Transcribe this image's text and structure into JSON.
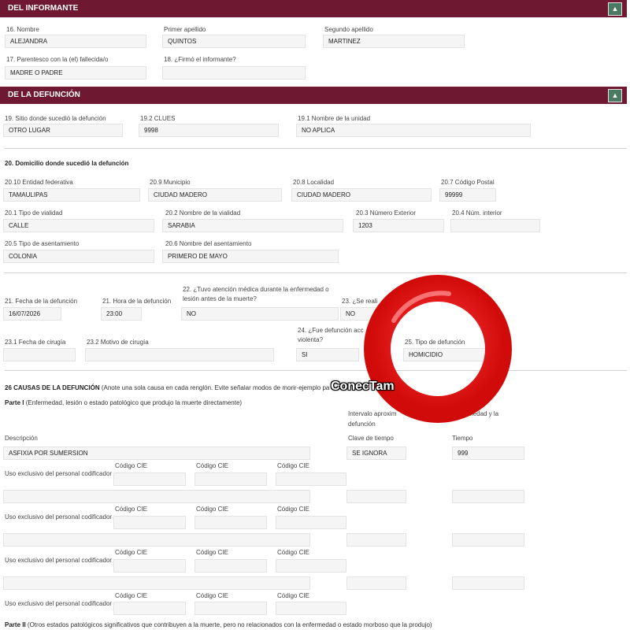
{
  "informante": {
    "header": "DEL INFORMANTE",
    "nombre_label": "16. Nombre",
    "nombre": "ALEJANDRA",
    "primer_apellido_label": "Primer apellido",
    "primer_apellido": "QUINTOS",
    "segundo_apellido_label": "Segundo apellido",
    "segundo_apellido": "MARTINEZ",
    "parentesco_label": "17. Parentesco con la (el) fallecida/o",
    "parentesco": "MADRE O PADRE",
    "firmo_label": "18. ¿Firmó el informante?",
    "firmo": ""
  },
  "defuncion": {
    "header": "DE LA DEFUNCIÓN",
    "sitio_label": "19. Sitio donde sucedió la defunción",
    "sitio": "OTRO LUGAR",
    "clues_label": "19.2 CLUES",
    "clues": "9998",
    "unidad_label": "19.1 Nombre de la unidad",
    "unidad": "NO APLICA",
    "domicilio_title": "20. Domicilio donde sucedió la defunción",
    "entidad_label": "20.10 Entidad federativa",
    "entidad": "TAMAULIPAS",
    "municipio_label": "20.9 Municipio",
    "municipio": "CIUDAD MADERO",
    "localidad_label": "20.8 Localidad",
    "localidad": "CIUDAD MADERO",
    "cp_label": "20.7 Código Postal",
    "cp": "99999",
    "tipo_vialidad_label": "20.1 Tipo de vialidad",
    "tipo_vialidad": "CALLE",
    "nombre_vialidad_label": "20.2 Nombre de la vialidad",
    "nombre_vialidad": "SARABIA",
    "num_ext_label": "20.3 Número Exterior",
    "num_ext": "1203",
    "num_int_label": "20.4 Núm. interior",
    "num_int": "",
    "tipo_asent_label": "20.5 Tipo de asentamiento",
    "tipo_asent": "COLONIA",
    "nombre_asent_label": "20.6 Nombre del asentamiento",
    "nombre_asent": "PRIMERO DE MAYO",
    "fecha_label": "21. Fecha de la defunción",
    "fecha": "16/07/2026",
    "hora_label": "21. Hora de la defunción",
    "hora": "23:00",
    "atencion_label": "22. ¿Tuvo atención médica durante la enfermedad o lesión antes de la muerte?",
    "atencion": "NO",
    "q23_label": "23. ¿Se reali",
    "q23": "NO",
    "cir_fecha_label": "23.1 Fecha de cirugía",
    "cir_fecha": "",
    "cir_motivo_label": "23.2 Motivo de cirugía",
    "cir_motivo": "",
    "violenta_label": "24. ¿Fue defunción acc violenta?",
    "violenta": "SI",
    "tipo_label": "25. Tipo de defunción",
    "tipo": "HOMICIDIO"
  },
  "causas": {
    "title": "26 CAUSAS DE LA DEFUNCIÓN",
    "title_note": "(Anote una sola causa en cada renglón. Evite señalar modos de morir-ejemplo pa",
    "parte1_title": "Parte I",
    "parte1_note": "(Enfermedad, lesión o estado patológico que produjo la muerte directamente)",
    "intervalo_label": "Intervalo aproxim",
    "intervalo_label_cont": "defunción",
    "intervalo_right": "medad y la",
    "descripcion_label": "Descripción",
    "clave_tiempo_label": "Clave de tiempo",
    "tiempo_label": "Tiempo",
    "descripcion": "ASFIXIA POR SUMERSION",
    "clave_tiempo": "SE IGNORA",
    "tiempo": "999",
    "uso_label": "Uso exclusivo del personal codificador",
    "codigo_label": "Código CIE",
    "parte2_title": "Parte II",
    "parte2_note": "(Otros estados patológicos significativos que contribuyen a la muerte, pero no relacionados con la enfermedad o estado morboso que la produjo)"
  },
  "icons": {
    "collapse": "chevron-up-icon"
  },
  "colors": {
    "header_bar": "#6e1831",
    "toggle": "#4a7a62",
    "ring": "#e50914"
  },
  "watermark": {
    "text": "ConecTam"
  }
}
